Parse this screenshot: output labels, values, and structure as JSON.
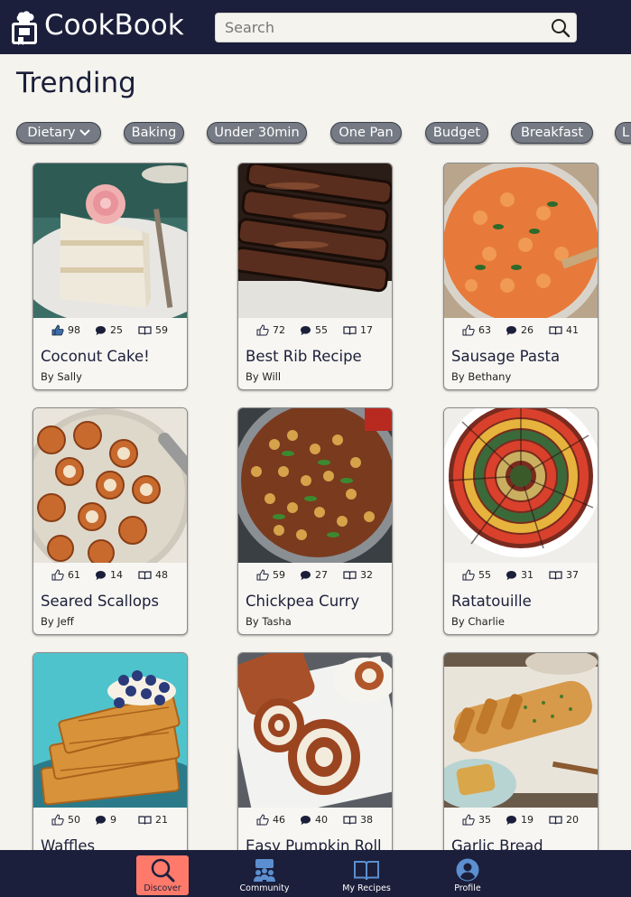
{
  "app": {
    "title": "CookBook"
  },
  "search": {
    "placeholder": "Search"
  },
  "page": {
    "title": "Trending"
  },
  "chips": [
    {
      "label": "Dietary",
      "has_dropdown": true
    },
    {
      "label": "Baking"
    },
    {
      "label": "Under 30min"
    },
    {
      "label": "One Pan"
    },
    {
      "label": "Budget"
    },
    {
      "label": "Breakfast"
    },
    {
      "label": "L"
    }
  ],
  "recipes": [
    {
      "title": "Coconut Cake!",
      "author": "By Sally",
      "likes": "98",
      "comments": "25",
      "saves": "59",
      "liked": true,
      "image": "coconut-cake-photo"
    },
    {
      "title": "Best Rib Recipe",
      "author": "By Will",
      "likes": "72",
      "comments": "55",
      "saves": "17",
      "image": "ribs-photo"
    },
    {
      "title": "Sausage Pasta",
      "author": "By Bethany",
      "likes": "63",
      "comments": "26",
      "saves": "41",
      "image": "sausage-pasta-photo"
    },
    {
      "title": "Seared Scallops",
      "author": "By Jeff",
      "likes": "61",
      "comments": "14",
      "saves": "48",
      "image": "scallops-photo"
    },
    {
      "title": "Chickpea Curry",
      "author": "By Tasha",
      "likes": "59",
      "comments": "27",
      "saves": "32",
      "image": "chickpea-curry-photo"
    },
    {
      "title": "Ratatouille",
      "author": "By Charlie",
      "likes": "55",
      "comments": "31",
      "saves": "37",
      "image": "ratatouille-photo"
    },
    {
      "title": "Waffles",
      "author": "",
      "likes": "50",
      "comments": "9",
      "saves": "21",
      "image": "waffles-photo"
    },
    {
      "title": "Easy Pumpkin Roll",
      "author": "",
      "likes": "46",
      "comments": "40",
      "saves": "38",
      "image": "pumpkin-roll-photo"
    },
    {
      "title": "Garlic Bread",
      "author": "",
      "likes": "35",
      "comments": "19",
      "saves": "20",
      "image": "garlic-bread-photo"
    }
  ],
  "nav": [
    {
      "label": "Discover",
      "icon": "search-icon",
      "active": true
    },
    {
      "label": "Community",
      "icon": "community-icon"
    },
    {
      "label": "My Recipes",
      "icon": "book-icon"
    },
    {
      "label": "Profile",
      "icon": "profile-icon"
    }
  ],
  "colors": {
    "header_bg": "#1b1f3b",
    "page_bg": "#f4f3ee",
    "chip_bg": "#757a84",
    "active_nav": "#ff7a6b",
    "like_active": "#3b6ea8"
  }
}
